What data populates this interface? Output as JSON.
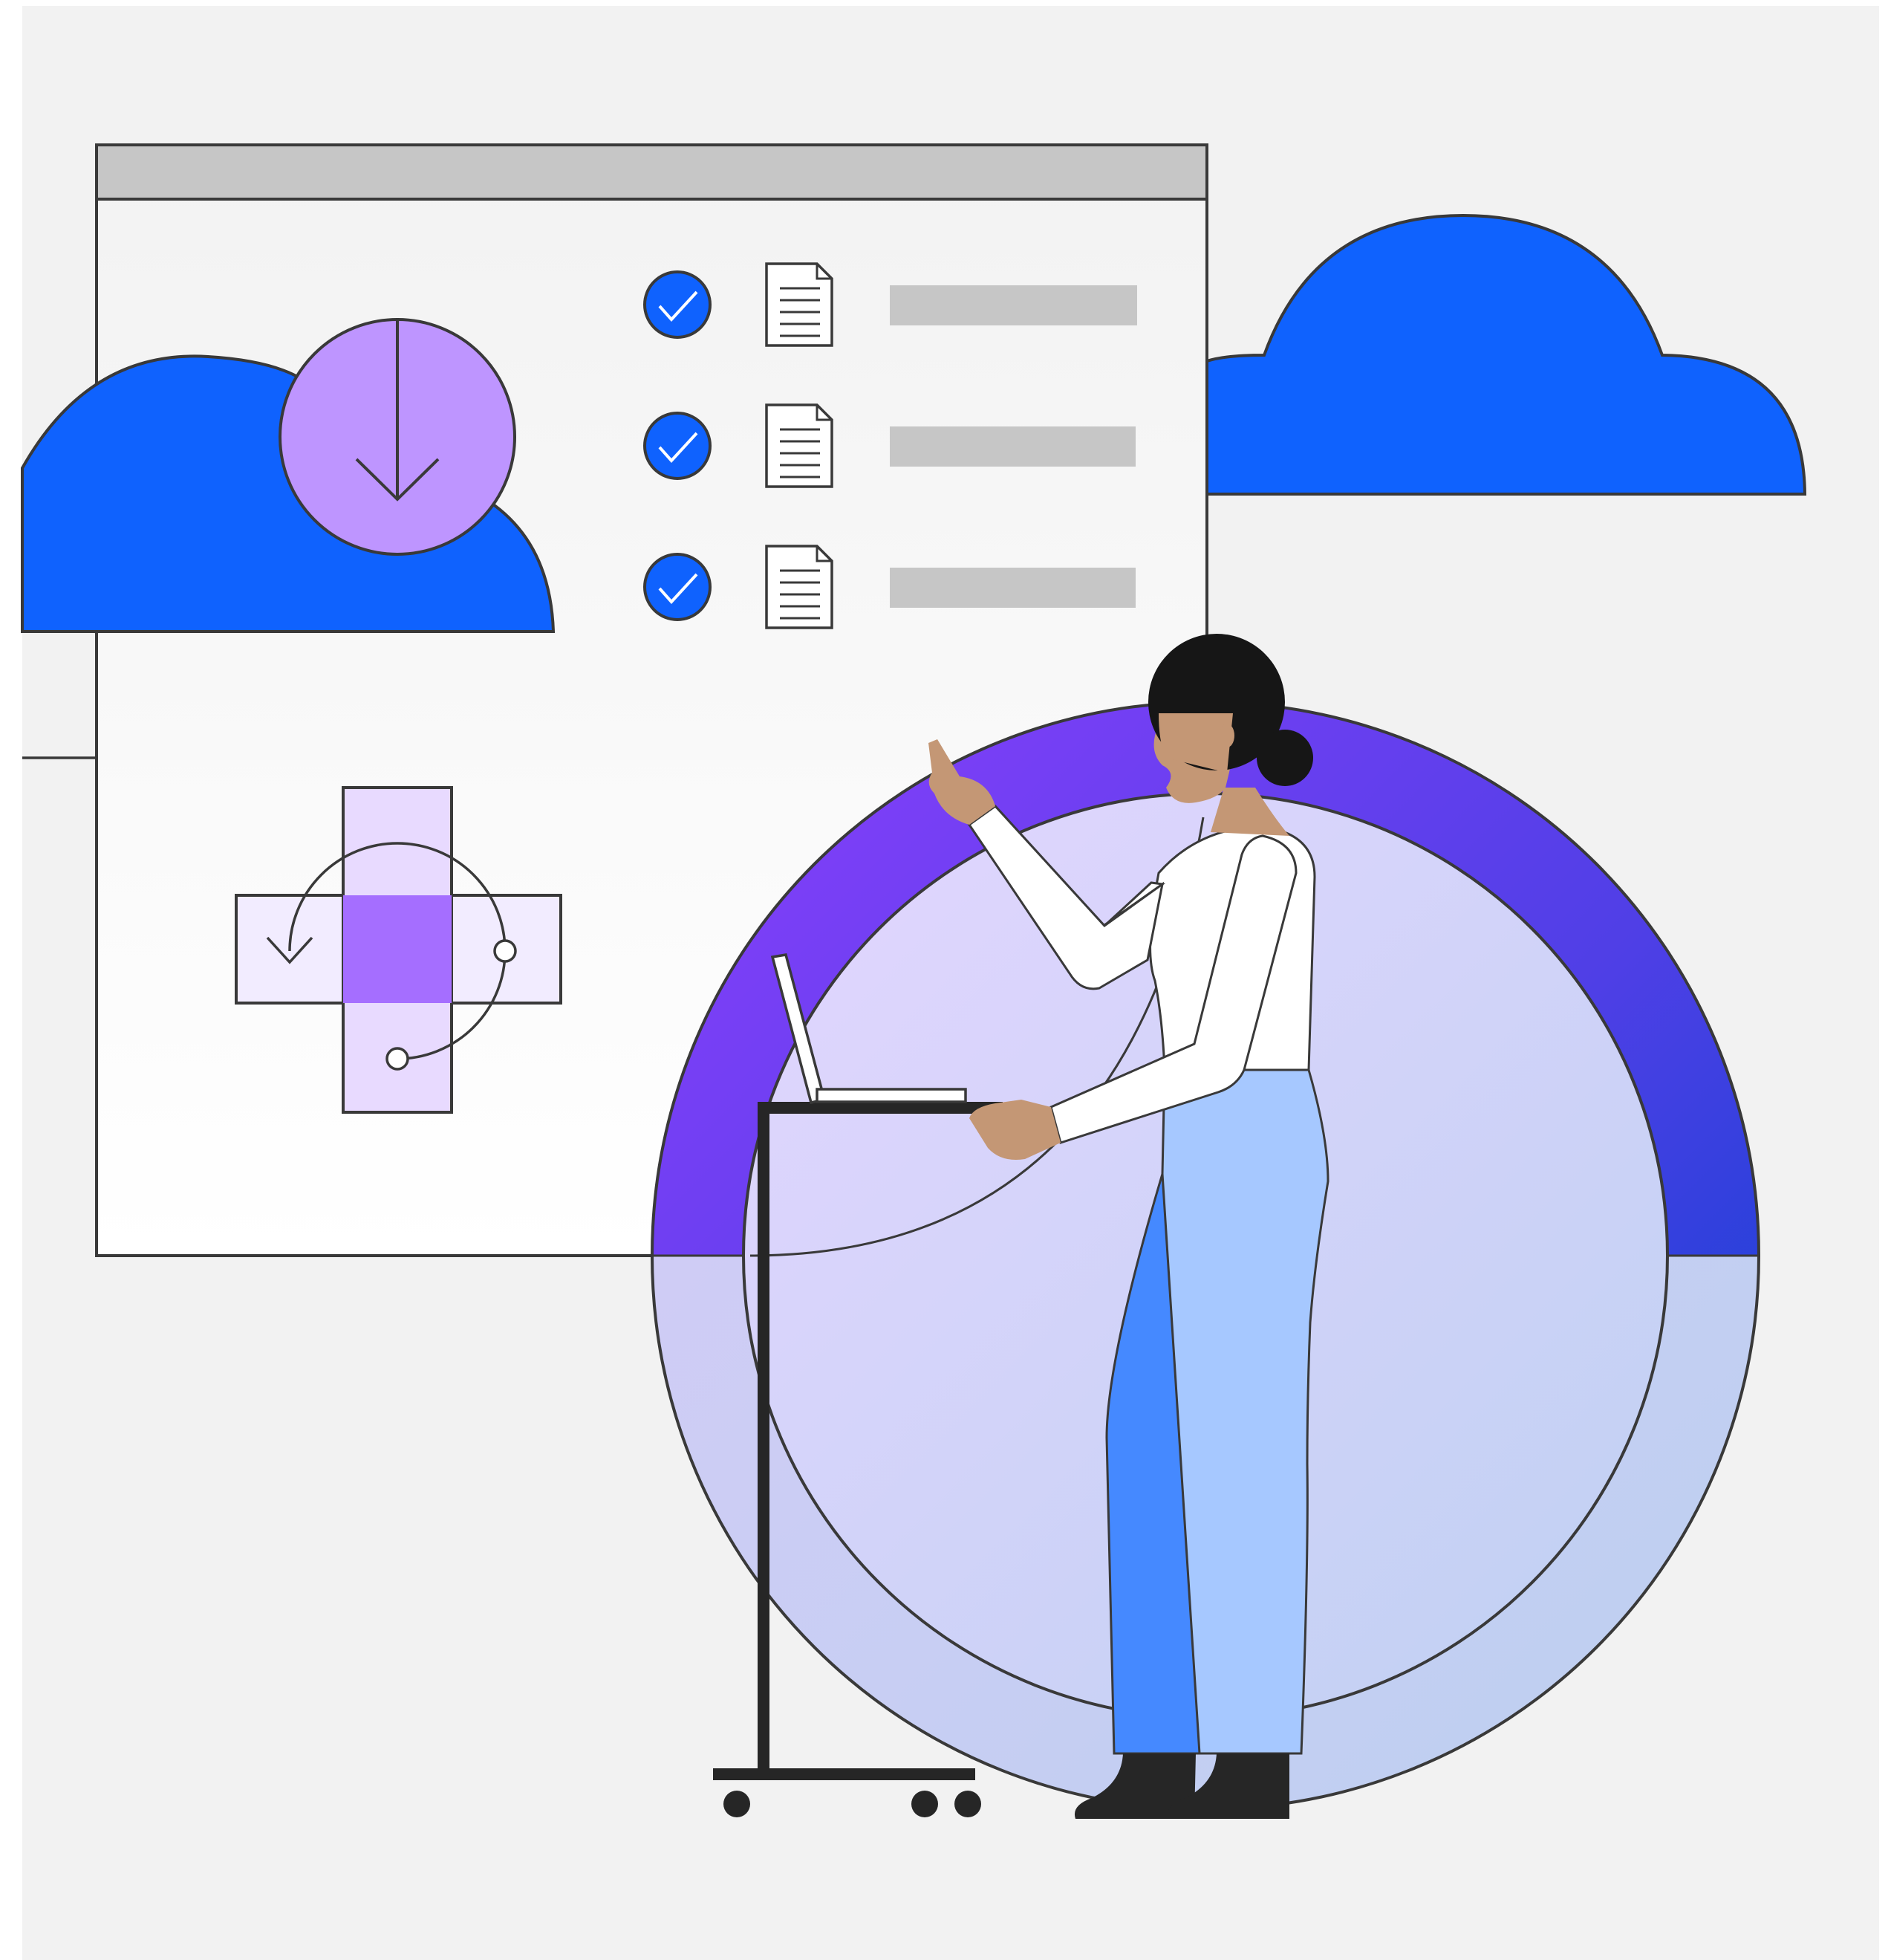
{
  "illustration": {
    "subject": "person-at-laptop-cloud-migration",
    "icons": [
      "cloud-icon",
      "download-icon",
      "check-icon",
      "document-icon",
      "transfer-icon",
      "laptop-icon"
    ],
    "checklist": [
      {
        "status": "checked"
      },
      {
        "status": "checked"
      },
      {
        "status": "checked"
      }
    ],
    "colors": {
      "background": "#f2f2f2",
      "cloud_blue": "#0f62fe",
      "check_blue": "#0f62fe",
      "lavender": "#be95ff",
      "light_lavender": "#e8daff",
      "purple": "#a56eff",
      "ring_purple": "#8a3ffc",
      "ring_blue": "#0043ce",
      "pants_light": "#a6c8ff",
      "pants_dark": "#4589ff",
      "skin": "#c49775",
      "hair": "#161616",
      "panel_gray": "#c6c6c6",
      "outline": "#393939"
    }
  }
}
